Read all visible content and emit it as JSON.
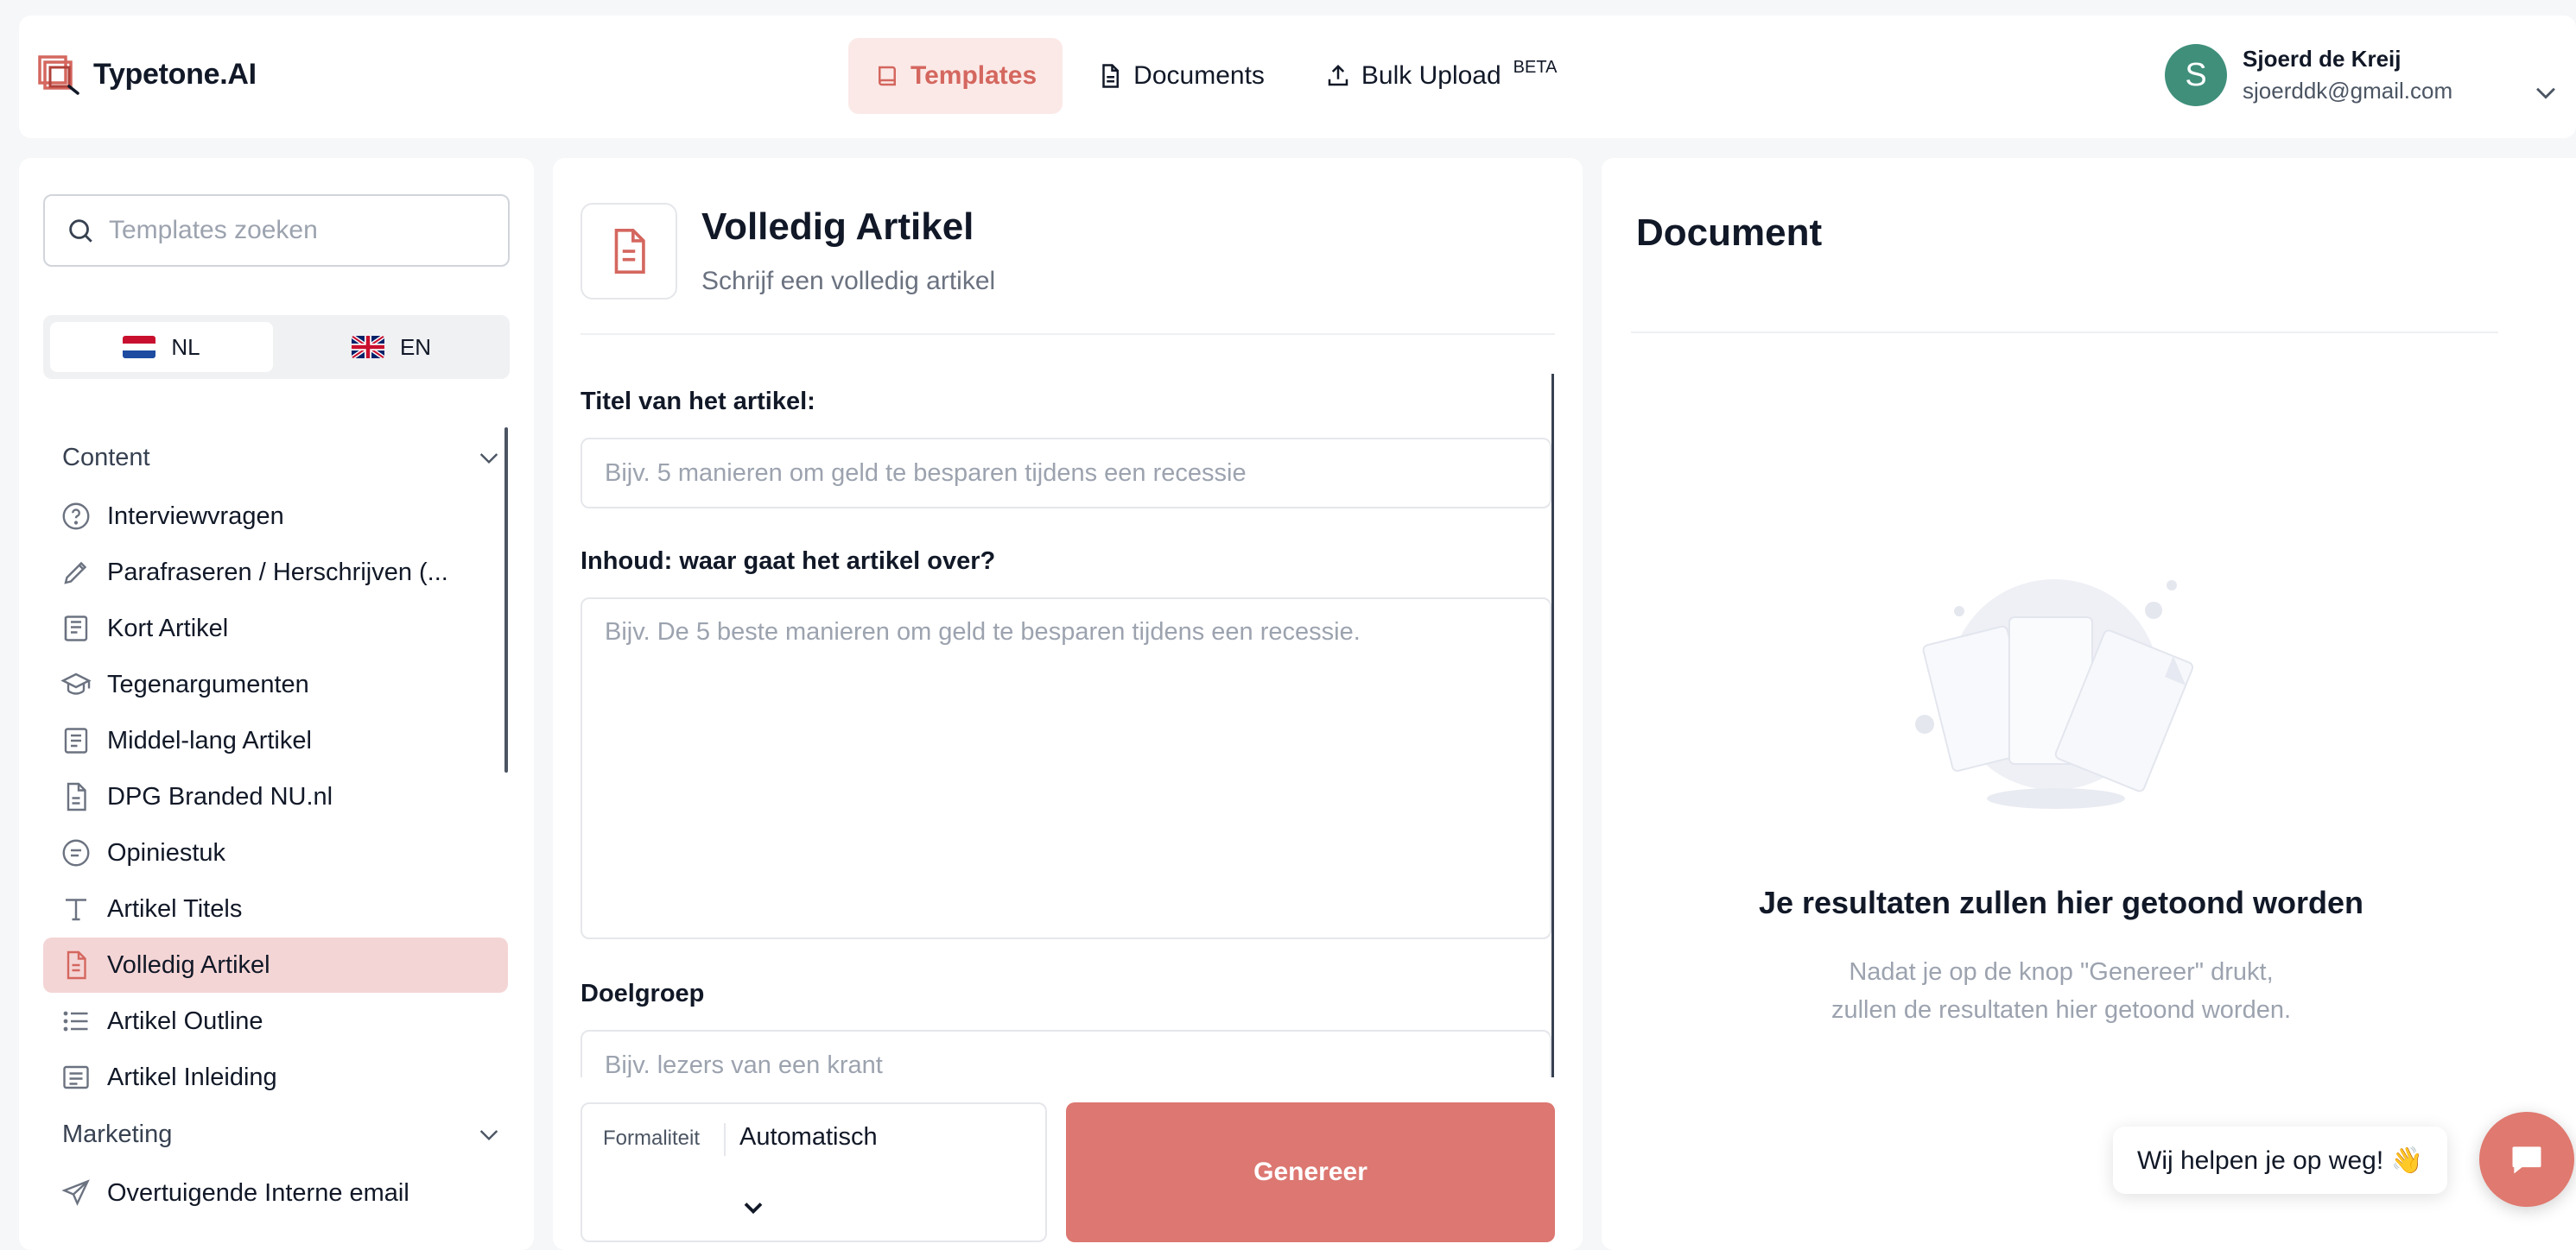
{
  "brand": {
    "name": "Typetone.AI"
  },
  "nav": {
    "items": [
      {
        "label": "Templates",
        "icon": "book-icon",
        "active": true
      },
      {
        "label": "Documents",
        "icon": "document-icon",
        "active": false
      },
      {
        "label": "Bulk Upload",
        "icon": "upload-icon",
        "active": false,
        "badge": "BETA"
      }
    ]
  },
  "user": {
    "initial": "S",
    "name": "Sjoerd de Kreij",
    "email": "sjoerddk@gmail.com"
  },
  "sidebar": {
    "search_placeholder": "Templates zoeken",
    "languages": [
      {
        "code": "NL",
        "active": true
      },
      {
        "code": "EN",
        "active": false
      }
    ],
    "sections": [
      {
        "title": "Content"
      },
      {
        "title": "Marketing"
      }
    ],
    "items": [
      {
        "label": "Interviewvragen",
        "icon": "question-circle-icon"
      },
      {
        "label": "Parafraseren / Herschrijven (...",
        "icon": "pencil-icon"
      },
      {
        "label": "Kort Artikel",
        "icon": "article-icon"
      },
      {
        "label": "Tegenargumenten",
        "icon": "graduation-cap-icon"
      },
      {
        "label": "Middel-lang Artikel",
        "icon": "document-lines-icon"
      },
      {
        "label": "DPG Branded NU.nl",
        "icon": "file-icon"
      },
      {
        "label": "Opiniestuk",
        "icon": "speech-bubble-icon"
      },
      {
        "label": "Artikel Titels",
        "icon": "text-t-icon"
      },
      {
        "label": "Volledig Artikel",
        "icon": "file-text-icon",
        "active": true
      },
      {
        "label": "Artikel Outline",
        "icon": "list-icon"
      },
      {
        "label": "Artikel Inleiding",
        "icon": "text-block-icon"
      }
    ],
    "marketing_items": [
      {
        "label": "Overtuigende Interne email",
        "icon": "paper-plane-icon"
      }
    ]
  },
  "template": {
    "title": "Volledig Artikel",
    "subtitle": "Schrijf een volledig artikel",
    "fields": [
      {
        "label": "Titel van het artikel:",
        "placeholder": "Bijv. 5 manieren om geld te besparen tijdens een recessie"
      },
      {
        "label": "Inhoud: waar gaat het artikel over?",
        "placeholder": "Bijv. De 5 beste manieren om geld te besparen tijdens een recessie."
      },
      {
        "label": "Doelgroep",
        "placeholder": "Bijv. lezers van een krant"
      }
    ],
    "formality": {
      "label": "Formaliteit",
      "value": "Automatisch"
    },
    "generate_label": "Genereer"
  },
  "document": {
    "title": "Document",
    "empty_title": "Je resultaten zullen hier getoond worden",
    "empty_text_line1": "Nadat je op de knop \"Genereer\" drukt,",
    "empty_text_line2": "zullen de resultaten hier getoond worden."
  },
  "help": {
    "text": "Wij helpen je op weg! 👋"
  },
  "colors": {
    "accent": "#dc7771",
    "accent_light": "#fbe9e7",
    "active_item": "#f4d5d5",
    "avatar": "#3f8f7b"
  }
}
